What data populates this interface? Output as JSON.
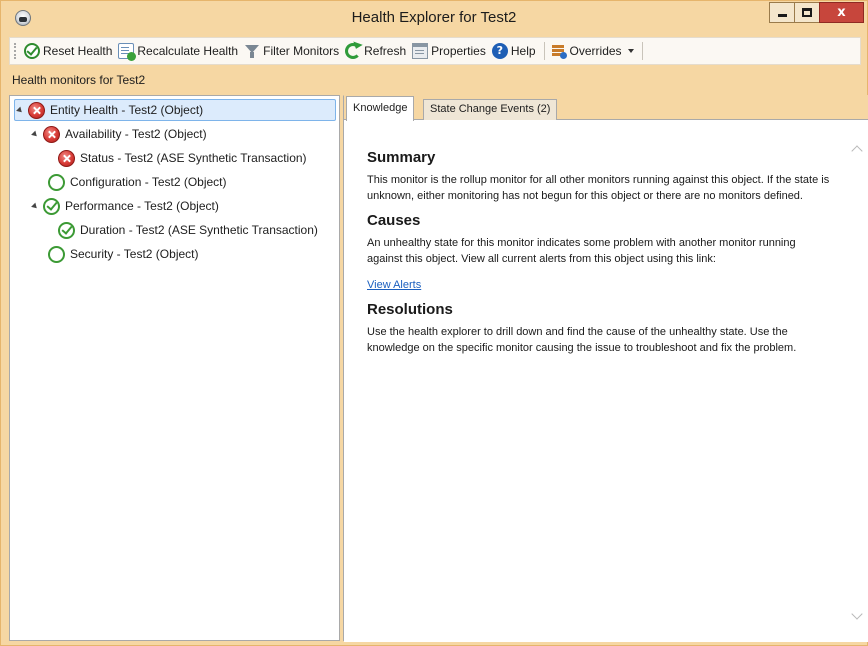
{
  "window": {
    "title": "Health Explorer for Test2",
    "close_label": "x"
  },
  "toolbar": {
    "reset_health": "Reset Health",
    "recalculate_health": "Recalculate Health",
    "filter_monitors": "Filter Monitors",
    "refresh": "Refresh",
    "properties": "Properties",
    "help": "Help",
    "help_icon_glyph": "?",
    "overrides": "Overrides"
  },
  "subheader": "Health monitors for Test2",
  "tree": {
    "items": [
      {
        "label": "Entity Health - Test2 (Object)",
        "state": "error",
        "icon": "error-icon",
        "expanded": true,
        "selected": true
      },
      {
        "label": "Availability - Test2 (Object)",
        "state": "error",
        "icon": "error-icon",
        "expanded": true
      },
      {
        "label": "Status - Test2 (ASE Synthetic Transaction)",
        "state": "error",
        "icon": "error-icon"
      },
      {
        "label": "Configuration - Test2 (Object)",
        "state": "empty",
        "icon": "empty-circle-icon"
      },
      {
        "label": "Performance - Test2 (Object)",
        "state": "ok",
        "icon": "healthy-icon",
        "expanded": true
      },
      {
        "label": "Duration - Test2 (ASE Synthetic Transaction)",
        "state": "ok",
        "icon": "healthy-icon"
      },
      {
        "label": "Security - Test2 (Object)",
        "state": "empty",
        "icon": "empty-circle-icon"
      }
    ]
  },
  "tabs": [
    {
      "label": "Knowledge",
      "active": true
    },
    {
      "label": "State Change Events (2)",
      "active": false
    }
  ],
  "knowledge": {
    "summary_heading": "Summary",
    "summary_text": "This monitor is the rollup monitor for all other monitors running against this object. If the state is unknown, either monitoring has not begun for this object or there are no monitors defined.",
    "causes_heading": "Causes",
    "causes_text": "An unhealthy state for this monitor indicates some problem with another monitor running against this object. View all current alerts from this object using this link:",
    "view_alerts_link": "View Alerts",
    "resolutions_heading": "Resolutions",
    "resolutions_text": "Use the health explorer to drill down and find the cause of the unhealthy state. Use the knowledge on the specific monitor causing the issue to troubleshoot and fix the problem."
  },
  "colors": {
    "frame": "#f6d7a3",
    "selection": "#dcebfc",
    "error": "#d83b36",
    "healthy": "#3c9a35",
    "link": "#1b5fbf",
    "close_button": "#c7463c"
  }
}
